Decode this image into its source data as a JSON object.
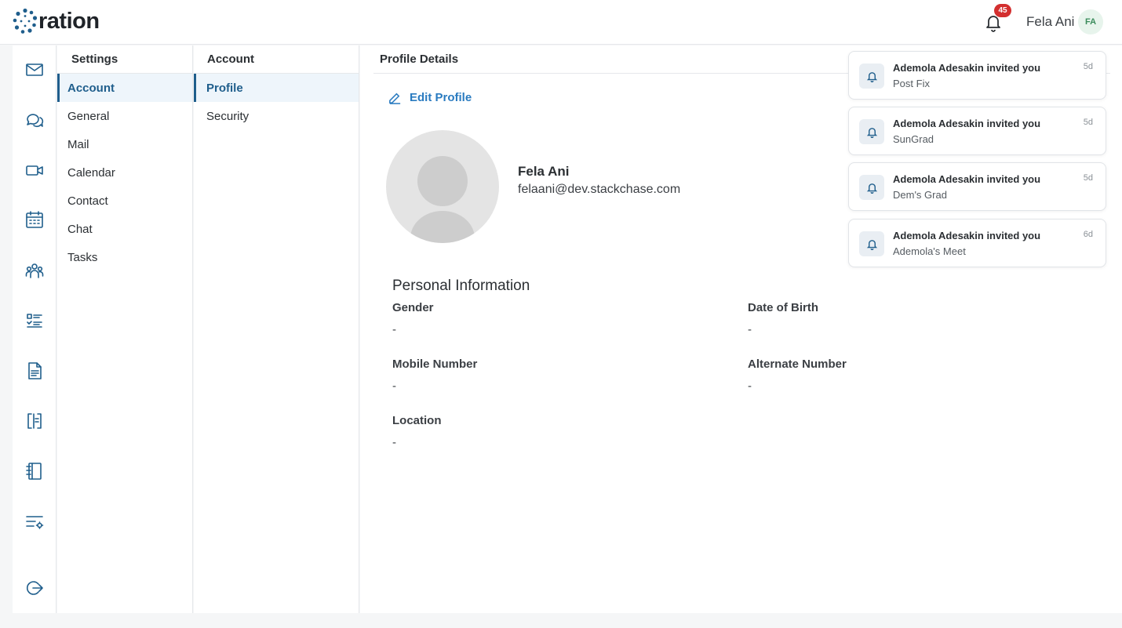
{
  "app": {
    "logo_text": "ration"
  },
  "header": {
    "user_name": "Fela Ani",
    "user_initials": "FA",
    "notification_count": "45"
  },
  "rail": {
    "icons": [
      "mail-icon",
      "chat-icon",
      "video-icon",
      "calendar-icon",
      "contacts-icon",
      "tasks-icon",
      "document-icon",
      "whiteboard-icon",
      "notebook-icon",
      "settings-list-icon",
      "logout-icon"
    ]
  },
  "settings_nav": {
    "title": "Settings",
    "items": [
      "Account",
      "General",
      "Mail",
      "Calendar",
      "Contact",
      "Chat",
      "Tasks"
    ]
  },
  "account_nav": {
    "title": "Account",
    "items": [
      "Profile",
      "Security"
    ]
  },
  "profile": {
    "header": "Profile Details",
    "edit_label": "Edit Profile",
    "name": "Fela Ani",
    "email": "felaani@dev.stackchase.com",
    "personal_title": "Personal Information",
    "fields": {
      "gender": {
        "label": "Gender",
        "value": "-"
      },
      "dob": {
        "label": "Date of Birth",
        "value": "-"
      },
      "mobile": {
        "label": "Mobile Number",
        "value": "-"
      },
      "alternate": {
        "label": "Alternate Number",
        "value": "-"
      },
      "location": {
        "label": "Location",
        "value": "-"
      }
    }
  },
  "notifications": [
    {
      "title": "Ademola Adesakin invited you",
      "subtitle": "Post Fix",
      "time": "5d"
    },
    {
      "title": "Ademola Adesakin invited you",
      "subtitle": "SunGrad",
      "time": "5d"
    },
    {
      "title": "Ademola Adesakin invited you",
      "subtitle": "Dem's Grad",
      "time": "5d"
    },
    {
      "title": "Ademola Adesakin invited you",
      "subtitle": "Ademola's Meet",
      "time": "6d"
    }
  ],
  "colors": {
    "accent": "#1f5e8c",
    "link": "#2a7bc0",
    "badge": "#d32f2f"
  }
}
